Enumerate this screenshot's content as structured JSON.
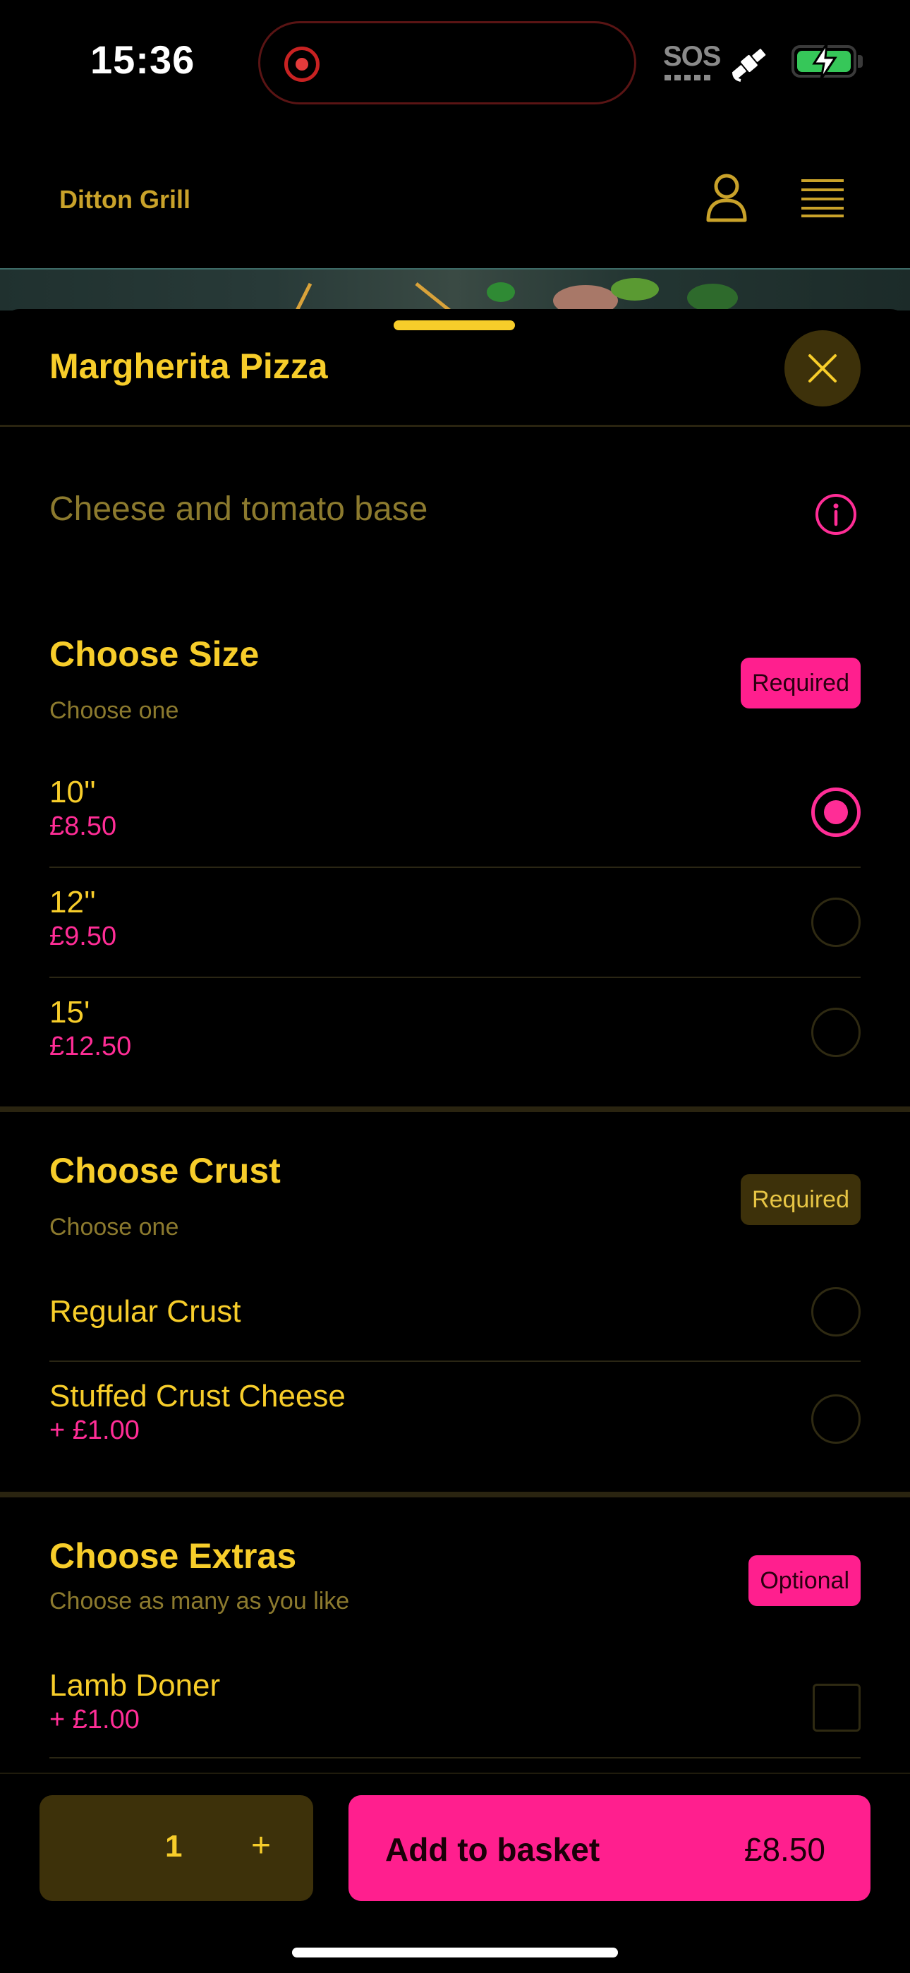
{
  "status_bar": {
    "time": "15:36",
    "sos": "SOS"
  },
  "header": {
    "restaurant_name": "Ditton Grill"
  },
  "sheet": {
    "title": "Margherita Pizza",
    "description": "Cheese and tomato base"
  },
  "groups": [
    {
      "title": "Choose Size",
      "subtitle": "Choose one",
      "badge": "Required",
      "options": [
        {
          "label": "10''",
          "price": "£8.50",
          "selected": true
        },
        {
          "label": "12''",
          "price": "£9.50",
          "selected": false
        },
        {
          "label": "15'",
          "price": "£12.50",
          "selected": false
        }
      ]
    },
    {
      "title": "Choose Crust",
      "subtitle": "Choose one",
      "badge": "Required",
      "options": [
        {
          "label": "Regular Crust",
          "price": "",
          "selected": false
        },
        {
          "label": "Stuffed Crust Cheese",
          "price": "+ £1.00",
          "selected": false
        }
      ]
    },
    {
      "title": "Choose Extras",
      "subtitle": "Choose as many as you like",
      "badge": "Optional",
      "options": [
        {
          "label": "Lamb Doner",
          "price": "+ £1.00",
          "selected": false
        }
      ]
    }
  ],
  "bottom_bar": {
    "quantity": "1",
    "plus": "+",
    "add_label": "Add to basket",
    "add_price": "£8.50"
  },
  "colors": {
    "accent": "#f7cd2a",
    "brand_pink": "#ff1f8e",
    "muted": "#8c7a2e"
  }
}
